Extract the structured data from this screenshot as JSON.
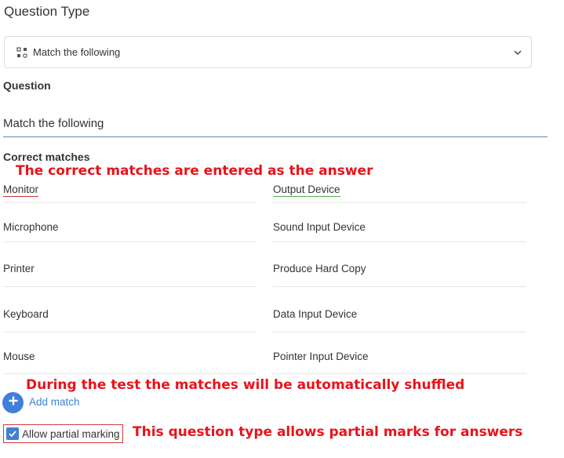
{
  "question_type": {
    "label": "Question Type",
    "selected": "Match the following",
    "icon": "match-grid-icon"
  },
  "question": {
    "label": "Question",
    "value": "Match the following"
  },
  "correct_matches": {
    "label": "Correct matches",
    "rows": [
      {
        "left": "Monitor",
        "right": "Output Device"
      },
      {
        "left": "Microphone",
        "right": "Sound Input Device"
      },
      {
        "left": "Printer",
        "right": "Produce Hard Copy"
      },
      {
        "left": "Keyboard",
        "right": "Data Input Device"
      },
      {
        "left": "Mouse",
        "right": "Pointer Input Device"
      }
    ]
  },
  "add_match": {
    "label": "Add match"
  },
  "partial_marking": {
    "label": "Allow partial marking",
    "checked": true
  },
  "annotations": {
    "answer_note": "The correct matches are entered as the answer",
    "shuffle_note": "During the test the matches will be automatically shuffled",
    "partial_note": "This question type allows partial marks for answers"
  },
  "colors": {
    "accent": "#3f7fd8",
    "annotation": "#e8121a"
  }
}
